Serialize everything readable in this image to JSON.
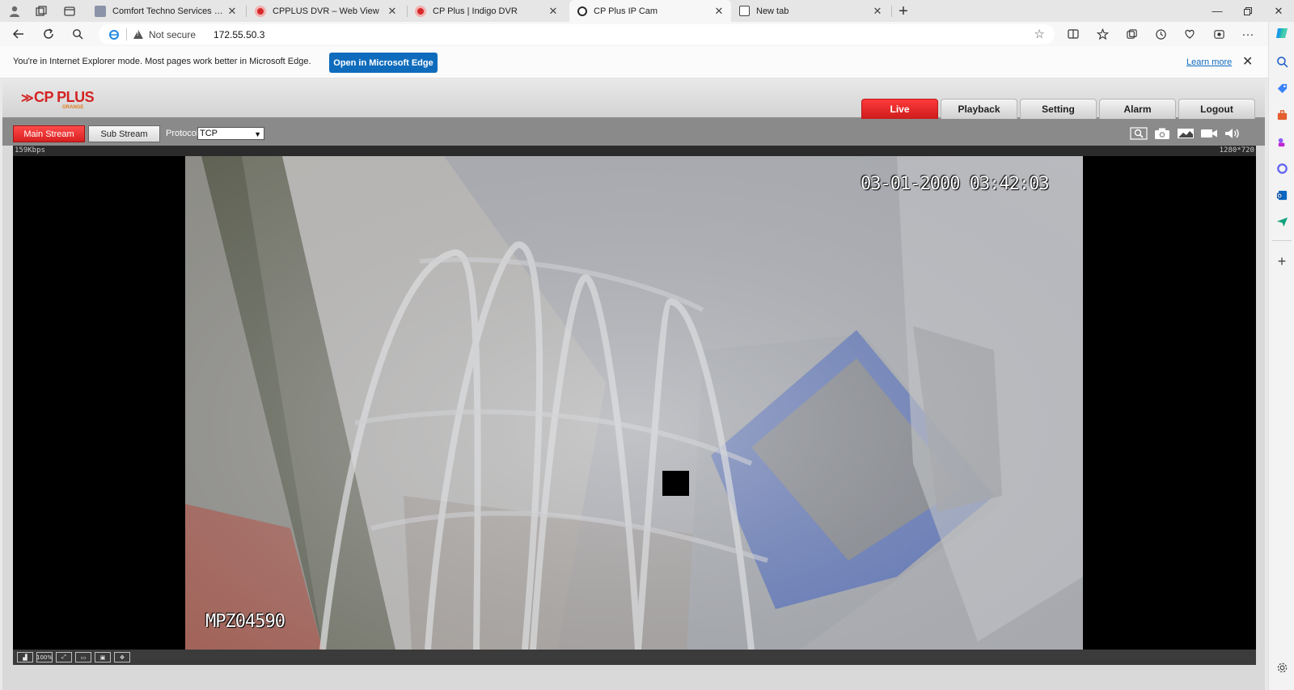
{
  "browser": {
    "tabs": [
      {
        "title": "Comfort Techno Services Pvt Ltd",
        "favicon": "vertex-favicon",
        "active": false
      },
      {
        "title": "CPPLUS DVR – Web View",
        "favicon": "cpplus-favicon",
        "active": false
      },
      {
        "title": "CP Plus | Indigo DVR",
        "favicon": "cpplus-favicon",
        "active": false
      },
      {
        "title": "CP Plus IP Cam",
        "favicon": "ie-favicon",
        "active": true
      },
      {
        "title": "New tab",
        "favicon": "newtab-favicon",
        "active": false
      }
    ],
    "address": {
      "security_label": "Not secure",
      "url": "172.55.50.3"
    }
  },
  "infobar": {
    "message": "You're in Internet Explorer mode. Most pages work better in Microsoft Edge.",
    "open_button": "Open in Microsoft Edge",
    "learn_more": "Learn more"
  },
  "dvr": {
    "logo_text": "CP PLUS",
    "logo_sub": "ORANGE",
    "nav": [
      "Live",
      "Playback",
      "Setting",
      "Alarm",
      "Logout"
    ],
    "active_nav": "Live",
    "main_stream": "Main Stream",
    "sub_stream": "Sub Stream",
    "protocol_label": "Protocol",
    "protocol_value": "TCP",
    "bitrate": "159Kbps",
    "resolution": "1280*720",
    "osd_timestamp": "03-01-2000 03:42:03",
    "osd_camera_name": "MPZ04590",
    "bottom_controls": [
      "100%"
    ]
  },
  "colors": {
    "accent_red": "#d82020",
    "edge_blue": "#0f6cbd"
  }
}
